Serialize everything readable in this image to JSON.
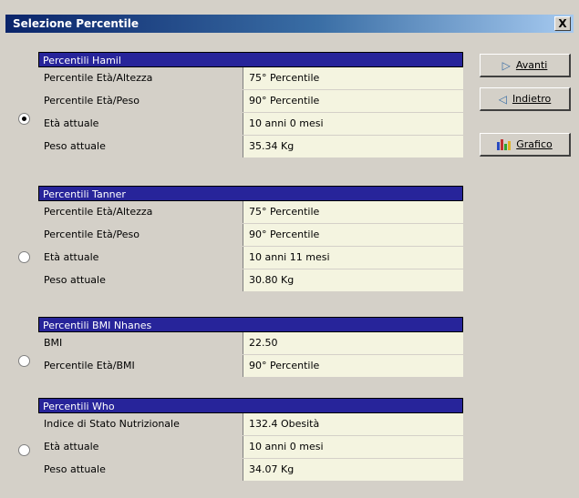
{
  "window": {
    "title": "Selezione Percentile",
    "close_label": "X"
  },
  "buttons": {
    "next_label": "Avanti",
    "back_label": "Indietro",
    "chart_label": "Grafico"
  },
  "groups": [
    {
      "title": "Percentili Hamil",
      "selected": true,
      "rows": [
        {
          "label": "Percentile Età/Altezza",
          "value": "75° Percentile"
        },
        {
          "label": "Percentile Età/Peso",
          "value": "90° Percentile"
        },
        {
          "label": "Età attuale",
          "value": "10 anni 0 mesi"
        },
        {
          "label": "Peso attuale",
          "value": "35.34 Kg"
        }
      ]
    },
    {
      "title": "Percentili Tanner",
      "selected": false,
      "rows": [
        {
          "label": "Percentile Età/Altezza",
          "value": "75° Percentile"
        },
        {
          "label": "Percentile Età/Peso",
          "value": "90° Percentile"
        },
        {
          "label": "Età attuale",
          "value": "10 anni 11 mesi"
        },
        {
          "label": "Peso attuale",
          "value": "30.80 Kg"
        }
      ]
    },
    {
      "title": "Percentili BMI Nhanes",
      "selected": false,
      "rows": [
        {
          "label": "BMI",
          "value": "22.50"
        },
        {
          "label": "Percentile Età/BMI",
          "value": "90° Percentile"
        }
      ]
    },
    {
      "title": "Percentili Who",
      "selected": false,
      "rows": [
        {
          "label": "Indice di Stato Nutrizionale",
          "value": "132.4 Obesità"
        },
        {
          "label": "Età attuale",
          "value": "10 anni 0 mesi"
        },
        {
          "label": "Peso attuale",
          "value": "34.07 Kg"
        }
      ]
    }
  ]
}
